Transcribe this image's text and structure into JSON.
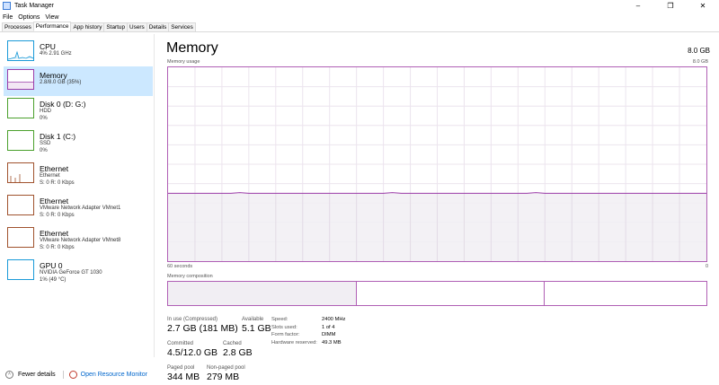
{
  "window": {
    "title": "Task Manager",
    "controls": {
      "minimize": "–",
      "maximize": "❐",
      "close": "✕"
    }
  },
  "menu": [
    "File",
    "Options",
    "View"
  ],
  "tabs": [
    "Processes",
    "Performance",
    "App history",
    "Startup",
    "Users",
    "Details",
    "Services"
  ],
  "active_tab": "Performance",
  "sidebar": {
    "items": [
      {
        "title": "CPU",
        "line1": "4%  2.91 GHz",
        "line2": "",
        "color": "#1a9ad8",
        "selected": false
      },
      {
        "title": "Memory",
        "line1": "2.8/8.0 GB (35%)",
        "line2": "",
        "color": "#9b3ca8",
        "selected": true
      },
      {
        "title": "Disk 0 (D: G:)",
        "line1": "HDD",
        "line2": "0%",
        "color": "#4aa02c",
        "selected": false
      },
      {
        "title": "Disk 1 (C:)",
        "line1": "SSD",
        "line2": "0%",
        "color": "#4aa02c",
        "selected": false
      },
      {
        "title": "Ethernet",
        "line1": "Ethernet",
        "line2": "S: 0 R: 0 Kbps",
        "color": "#a0522d",
        "selected": false
      },
      {
        "title": "Ethernet",
        "line1": "VMware Network Adapter VMnet1",
        "line2": "S: 0 R: 0 Kbps",
        "color": "#a0522d",
        "selected": false
      },
      {
        "title": "Ethernet",
        "line1": "VMware Network Adapter VMnet8",
        "line2": "S: 0 R: 0 Kbps",
        "color": "#a0522d",
        "selected": false
      },
      {
        "title": "GPU 0",
        "line1": "NVIDIA GeForce GT 1030",
        "line2": "1% (49 °C)",
        "color": "#1a9ad8",
        "selected": false
      }
    ]
  },
  "main": {
    "title": "Memory",
    "total": "8.0 GB",
    "usage_label": "Memory usage",
    "usage_max": "8.0 GB",
    "axis_left": "60 seconds",
    "axis_right": "0",
    "composition_label": "Memory composition",
    "graph_color": "#9b3ca8",
    "graph_fill": "#f1eef3",
    "usage_fraction": 0.35,
    "composition_fractions": [
      0.35,
      0.35,
      0.3
    ],
    "stats": {
      "in_use_label": "In use (Compressed)",
      "in_use_value": "2.7 GB (181 MB)",
      "available_label": "Available",
      "available_value": "5.1 GB",
      "committed_label": "Committed",
      "committed_value": "4.5/12.0 GB",
      "cached_label": "Cached",
      "cached_value": "2.8 GB",
      "paged_label": "Paged pool",
      "paged_value": "344 MB",
      "nonpaged_label": "Non-paged pool",
      "nonpaged_value": "279 MB"
    },
    "details": [
      {
        "label": "Speed:",
        "value": "2400 MHz"
      },
      {
        "label": "Slots used:",
        "value": "1 of 4"
      },
      {
        "label": "Form factor:",
        "value": "DIMM"
      },
      {
        "label": "Hardware reserved:",
        "value": "49.3 MB"
      }
    ]
  },
  "footer": {
    "fewer_details": "Fewer details",
    "resource_monitor": "Open Resource Monitor"
  }
}
